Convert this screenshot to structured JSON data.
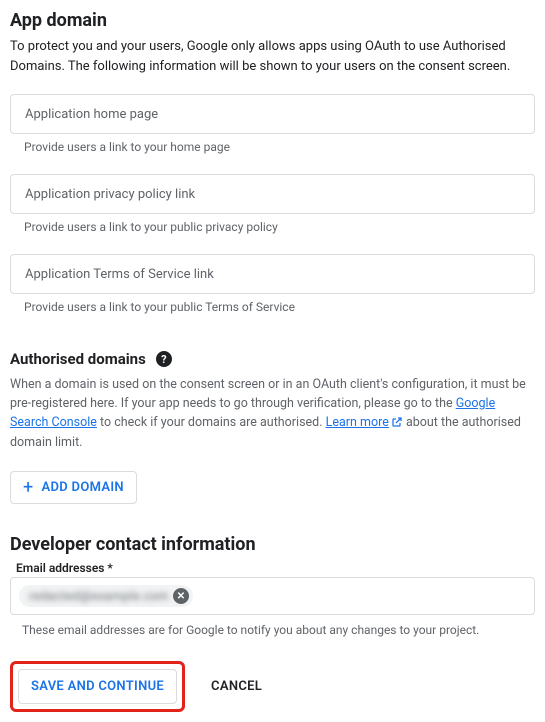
{
  "app_domain": {
    "heading": "App domain",
    "description": "To protect you and your users, Google only allows apps using OAuth to use Authorised Domains. The following information will be shown to your users on the consent screen.",
    "fields": {
      "home_page": {
        "placeholder": "Application home page",
        "helper": "Provide users a link to your home page"
      },
      "privacy": {
        "placeholder": "Application privacy policy link",
        "helper": "Provide users a link to your public privacy policy"
      },
      "tos": {
        "placeholder": "Application Terms of Service link",
        "helper": "Provide users a link to your public Terms of Service"
      }
    }
  },
  "authorised_domains": {
    "heading": "Authorised domains",
    "help_glyph": "?",
    "para_parts": {
      "p1": "When a domain is used on the consent screen or in an OAuth client's configuration, it must be pre-registered here. If your app needs to go through verification, please go to the ",
      "link1": "Google Search Console",
      "p2": " to check if your domains are authorised. ",
      "link2": "Learn more",
      "p3": " about the authorised domain limit."
    },
    "add_button": "ADD DOMAIN"
  },
  "developer_contact": {
    "heading": "Developer contact information",
    "label": "Email addresses *",
    "chip_value": "redacted@example.com",
    "helper": "These email addresses are for Google to notify you about any changes to your project."
  },
  "actions": {
    "save": "SAVE AND CONTINUE",
    "cancel": "CANCEL"
  }
}
